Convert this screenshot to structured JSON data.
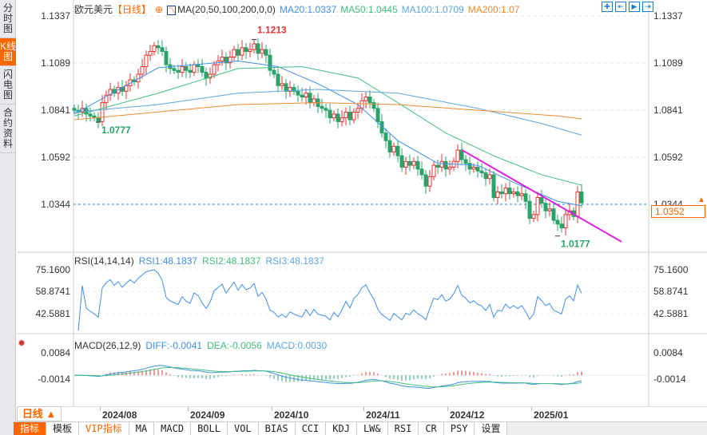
{
  "sidebar": {
    "items": [
      {
        "label": "分时图"
      },
      {
        "label": "K线图",
        "active": true
      },
      {
        "label": "闪电图"
      },
      {
        "label": "合约资料"
      }
    ]
  },
  "header": {
    "symbol": "欧元美元",
    "period": "【日线】",
    "ma_label": "MA(20,50,100,200,0,0)",
    "ma20": "MA20:1.0337",
    "ma50": "MA50:1.0445",
    "ma100": "MA100:1.0709",
    "ma200": "MA200:1.07"
  },
  "toolbar": {
    "icons": [
      "crosshair-icon",
      "zoom-in-icon",
      "zoom-out-icon",
      "move-right-icon"
    ]
  },
  "colors": {
    "up": "#e23434",
    "down": "#2aa36b",
    "ma20": "#3f8fe8",
    "ma50": "#3fbf7f",
    "ma100": "#5aa8e0",
    "ma200": "#f08a30",
    "trend": "#e020e0",
    "accent": "#ff6600"
  },
  "price_axis": {
    "labels": [
      "1.1337",
      "1.1089",
      "1.0841",
      "1.0592",
      "1.0344"
    ],
    "values": [
      1.1337,
      1.1089,
      1.0841,
      1.0592,
      1.0344
    ],
    "current": "1.0352",
    "current_value": 1.0352
  },
  "annotations": {
    "high": "1.1213",
    "high_value": 1.1213,
    "high_bar": 45,
    "low1": "1.0777",
    "low1_value": 1.0777,
    "low1_bar": 6,
    "low2": "1.0177",
    "low2_value": 1.0177,
    "low2_bar": 121
  },
  "chart_data": {
    "type": "candlestick",
    "closes": [
      1.084,
      1.083,
      1.085,
      1.082,
      1.081,
      1.08,
      1.078,
      1.088,
      1.092,
      1.095,
      1.093,
      1.096,
      1.094,
      1.097,
      1.1,
      1.099,
      1.103,
      1.107,
      1.113,
      1.115,
      1.118,
      1.117,
      1.115,
      1.108,
      1.106,
      1.105,
      1.104,
      1.107,
      1.105,
      1.104,
      1.108,
      1.107,
      1.104,
      1.101,
      1.103,
      1.108,
      1.11,
      1.112,
      1.109,
      1.112,
      1.116,
      1.113,
      1.117,
      1.115,
      1.116,
      1.119,
      1.114,
      1.116,
      1.113,
      1.105,
      1.103,
      1.097,
      1.098,
      1.094,
      1.096,
      1.094,
      1.092,
      1.091,
      1.093,
      1.088,
      1.09,
      1.086,
      1.085,
      1.084,
      1.08,
      1.082,
      1.078,
      1.08,
      1.083,
      1.079,
      1.083,
      1.085,
      1.089,
      1.091,
      1.088,
      1.085,
      1.078,
      1.072,
      1.068,
      1.062,
      1.065,
      1.06,
      1.054,
      1.057,
      1.055,
      1.057,
      1.053,
      1.05,
      1.044,
      1.049,
      1.055,
      1.054,
      1.057,
      1.053,
      1.054,
      1.057,
      1.063,
      1.058,
      1.056,
      1.053,
      1.054,
      1.052,
      1.051,
      1.048,
      1.05,
      1.038,
      1.041,
      1.04,
      1.043,
      1.04,
      1.041,
      1.039,
      1.04,
      1.036,
      1.027,
      1.029,
      1.038,
      1.035,
      1.031,
      1.032,
      1.026,
      1.024,
      1.022,
      1.029,
      1.031,
      1.028,
      1.041,
      1.0352
    ],
    "ma20": [
      [
        0,
        1.082
      ],
      [
        21,
        1.1064
      ],
      [
        41,
        1.11
      ],
      [
        51,
        1.107
      ],
      [
        61,
        1.098
      ],
      [
        71,
        1.087
      ],
      [
        81,
        1.068
      ],
      [
        91,
        1.056
      ],
      [
        101,
        1.055
      ],
      [
        111,
        1.045
      ],
      [
        121,
        1.036
      ],
      [
        127,
        1.0337
      ]
    ],
    "ma50": [
      [
        0,
        1.081
      ],
      [
        21,
        1.093
      ],
      [
        41,
        1.106
      ],
      [
        57,
        1.107
      ],
      [
        71,
        1.101
      ],
      [
        81,
        1.088
      ],
      [
        93,
        1.072
      ],
      [
        105,
        1.06
      ],
      [
        117,
        1.05
      ],
      [
        127,
        1.0445
      ]
    ],
    "ma100": [
      [
        0,
        1.083
      ],
      [
        21,
        1.087
      ],
      [
        41,
        1.093
      ],
      [
        61,
        1.095
      ],
      [
        81,
        1.093
      ],
      [
        101,
        1.085
      ],
      [
        117,
        1.077
      ],
      [
        127,
        1.0709
      ]
    ],
    "ma200": [
      [
        0,
        1.079
      ],
      [
        41,
        1.087
      ],
      [
        61,
        1.088
      ],
      [
        81,
        1.087
      ],
      [
        101,
        1.084
      ],
      [
        121,
        1.081
      ],
      [
        127,
        1.0795
      ]
    ],
    "trendline": [
      [
        97,
        1.0631
      ],
      [
        137,
        1.0147
      ]
    ],
    "x_labels": [
      {
        "label": "2024/08",
        "bar": 7
      },
      {
        "label": "2024/09",
        "bar": 29
      },
      {
        "label": "2024/10",
        "bar": 50
      },
      {
        "label": "2024/11",
        "bar": 73
      },
      {
        "label": "2024/12",
        "bar": 94
      },
      {
        "label": "2025/01",
        "bar": 115
      }
    ]
  },
  "rsi": {
    "title": "RSI(14,14,14)",
    "rsi1": "RSI1:48.1837",
    "rsi2": "RSI2:48.1837",
    "rsi3": "RSI3:48.1837",
    "labels": [
      "75.1600",
      "58.8741",
      "42.5881"
    ],
    "values": [
      75.16,
      58.8741,
      42.5881
    ]
  },
  "macd": {
    "title": "MACD(26,12,9)",
    "diff": "DIFF:-0.0041",
    "dea": "DEA:-0.0056",
    "macd": "MACD:0.0030",
    "labels": [
      "0.0084",
      "-0.0014"
    ],
    "values": [
      0.0084,
      -0.0014
    ]
  },
  "bottom": {
    "period_button": "日线 ▲",
    "tabs": [
      "指标",
      "模板",
      "VIP指标",
      "MA",
      "MACD",
      "BOLL",
      "VOL",
      "BIAS",
      "CCI",
      "KDJ",
      "LW&",
      "RSI",
      "CR",
      "PSY",
      "设置"
    ]
  }
}
